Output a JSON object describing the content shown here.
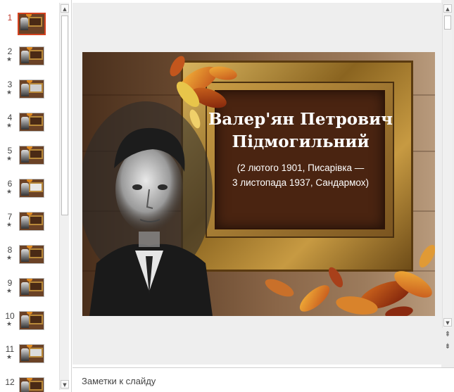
{
  "thumbnails": {
    "items": [
      {
        "num": "1",
        "star": ""
      },
      {
        "num": "2",
        "star": "★"
      },
      {
        "num": "3",
        "star": "★"
      },
      {
        "num": "4",
        "star": "★"
      },
      {
        "num": "5",
        "star": "★"
      },
      {
        "num": "6",
        "star": "★"
      },
      {
        "num": "7",
        "star": "★"
      },
      {
        "num": "8",
        "star": "★"
      },
      {
        "num": "9",
        "star": "★"
      },
      {
        "num": "10",
        "star": "★"
      },
      {
        "num": "11",
        "star": "★"
      },
      {
        "num": "12",
        "star": ""
      }
    ],
    "selected": "1"
  },
  "slide": {
    "title_line1": "Валер'ян Петрович",
    "title_line2": "Підмогильний",
    "subtitle_line1": "(2 лютого 1901, Писарівка —",
    "subtitle_line2": "3 листопада 1937, Сандармох)"
  },
  "notes": {
    "placeholder": "Заметки к слайду"
  },
  "icons": {
    "scroll_up": "▲",
    "scroll_down": "▼",
    "prev_slide": "⇞",
    "next_slide": "⇟"
  },
  "colors": {
    "selection": "#d3421f",
    "slide_title": "#ffffff"
  }
}
